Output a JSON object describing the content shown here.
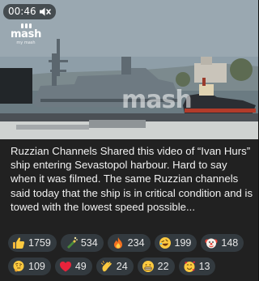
{
  "video": {
    "time_label": "00:46",
    "mute_icon": "speaker-muted-icon",
    "logo": {
      "word": "mash",
      "sub": "my mash"
    },
    "watermark": "mash"
  },
  "caption": "Ruzzian Channels Shared this video of “Ivan Hurs” ship entering Sevastopol harbour. Hard to say when it was filmed. The same Ruzzian channels said today that the ship is in critical condition and is towed with the lowest speed possible...",
  "reactions": [
    {
      "icon": "thumbs-up-icon",
      "count": "1759"
    },
    {
      "icon": "champagne-icon",
      "count": "534"
    },
    {
      "icon": "fire-icon",
      "count": "234"
    },
    {
      "icon": "rofl-face-icon",
      "count": "199"
    },
    {
      "icon": "clown-face-icon",
      "count": "148"
    },
    {
      "icon": "thinking-face-icon",
      "count": "109"
    },
    {
      "icon": "red-heart-icon",
      "count": "49"
    },
    {
      "icon": "clapping-hands-icon",
      "count": "24"
    },
    {
      "icon": "grimacing-face-icon",
      "count": "22"
    },
    {
      "icon": "smiling-hearts-face-icon",
      "count": "13"
    }
  ],
  "colors": {
    "background": "#212121",
    "reaction_pill": "#333a3f",
    "text": "#f1f1f1"
  }
}
